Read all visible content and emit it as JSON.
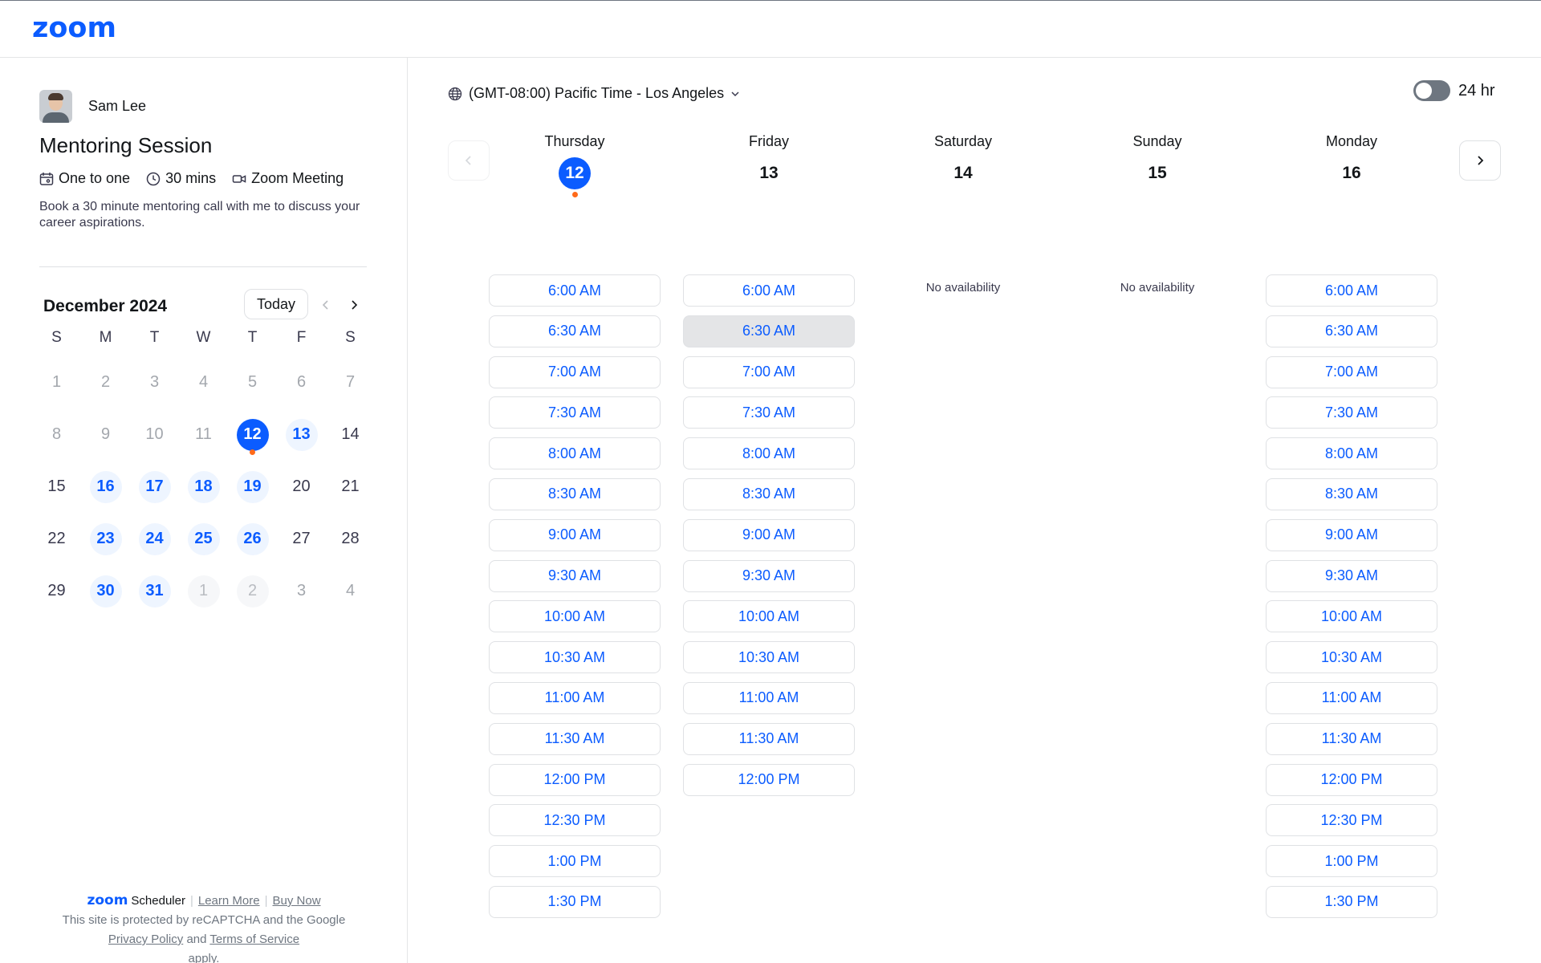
{
  "brand": {
    "logo_text": "zoom",
    "accent": "#0b5cff",
    "dot_color": "#ff6a1a"
  },
  "host": {
    "name": "Sam Lee",
    "avatar_icon": "user-photo"
  },
  "event": {
    "title": "Mentoring Session",
    "type_label": "One to one",
    "duration_label": "30 mins",
    "location_label": "Zoom Meeting",
    "description": "Book a 30 minute mentoring call with me to discuss your career aspirations."
  },
  "calendar": {
    "month_label": "December 2024",
    "today_label": "Today",
    "weekdays": [
      "S",
      "M",
      "T",
      "W",
      "T",
      "F",
      "S"
    ],
    "days": [
      {
        "label": "1",
        "state": "past"
      },
      {
        "label": "2",
        "state": "past"
      },
      {
        "label": "3",
        "state": "past"
      },
      {
        "label": "4",
        "state": "past"
      },
      {
        "label": "5",
        "state": "past"
      },
      {
        "label": "6",
        "state": "past"
      },
      {
        "label": "7",
        "state": "past"
      },
      {
        "label": "8",
        "state": "past"
      },
      {
        "label": "9",
        "state": "past"
      },
      {
        "label": "10",
        "state": "past"
      },
      {
        "label": "11",
        "state": "past"
      },
      {
        "label": "12",
        "state": "selected"
      },
      {
        "label": "13",
        "state": "avail"
      },
      {
        "label": "14",
        "state": "normal"
      },
      {
        "label": "15",
        "state": "normal"
      },
      {
        "label": "16",
        "state": "avail"
      },
      {
        "label": "17",
        "state": "avail"
      },
      {
        "label": "18",
        "state": "avail"
      },
      {
        "label": "19",
        "state": "avail"
      },
      {
        "label": "20",
        "state": "normal"
      },
      {
        "label": "21",
        "state": "normal"
      },
      {
        "label": "22",
        "state": "normal"
      },
      {
        "label": "23",
        "state": "avail"
      },
      {
        "label": "24",
        "state": "avail"
      },
      {
        "label": "25",
        "state": "avail"
      },
      {
        "label": "26",
        "state": "avail"
      },
      {
        "label": "27",
        "state": "normal"
      },
      {
        "label": "28",
        "state": "normal"
      },
      {
        "label": "29",
        "state": "normal"
      },
      {
        "label": "30",
        "state": "avail"
      },
      {
        "label": "31",
        "state": "avail"
      },
      {
        "label": "1",
        "state": "next-month"
      },
      {
        "label": "2",
        "state": "next-month"
      },
      {
        "label": "3",
        "state": "past"
      },
      {
        "label": "4",
        "state": "past"
      }
    ]
  },
  "footer": {
    "brand_logo": "zoom",
    "brand_product": "Scheduler",
    "learn_more": "Learn More",
    "buy_now": "Buy Now",
    "recaptcha_text_1": "This site is protected by reCAPTCHA and the Google",
    "privacy_policy": "Privacy Policy",
    "and_text": "and",
    "terms": "Terms of Service",
    "apply_text": "apply."
  },
  "timezone": {
    "label": "(GMT-08:00) Pacific Time - Los Angeles"
  },
  "toggle": {
    "label": "24 hr",
    "on": false
  },
  "schedule": {
    "no_availability_label": "No availability",
    "columns": [
      {
        "day_name": "Thursday",
        "day_num": "12",
        "selected": true,
        "slots": [
          "6:00 AM",
          "6:30 AM",
          "7:00 AM",
          "7:30 AM",
          "8:00 AM",
          "8:30 AM",
          "9:00 AM",
          "9:30 AM",
          "10:00 AM",
          "10:30 AM",
          "11:00 AM",
          "11:30 AM",
          "12:00 PM",
          "12:30 PM",
          "1:00 PM",
          "1:30 PM"
        ]
      },
      {
        "day_name": "Friday",
        "day_num": "13",
        "selected": false,
        "hovered_slot": "6:30 AM",
        "slots": [
          "6:00 AM",
          "6:30 AM",
          "7:00 AM",
          "7:30 AM",
          "8:00 AM",
          "8:30 AM",
          "9:00 AM",
          "9:30 AM",
          "10:00 AM",
          "10:30 AM",
          "11:00 AM",
          "11:30 AM",
          "12:00 PM"
        ]
      },
      {
        "day_name": "Saturday",
        "day_num": "14",
        "selected": false,
        "slots": []
      },
      {
        "day_name": "Sunday",
        "day_num": "15",
        "selected": false,
        "slots": []
      },
      {
        "day_name": "Monday",
        "day_num": "16",
        "selected": false,
        "slots": [
          "6:00 AM",
          "6:30 AM",
          "7:00 AM",
          "7:30 AM",
          "8:00 AM",
          "8:30 AM",
          "9:00 AM",
          "9:30 AM",
          "10:00 AM",
          "10:30 AM",
          "11:00 AM",
          "11:30 AM",
          "12:00 PM",
          "12:30 PM",
          "1:00 PM",
          "1:30 PM"
        ]
      }
    ]
  }
}
